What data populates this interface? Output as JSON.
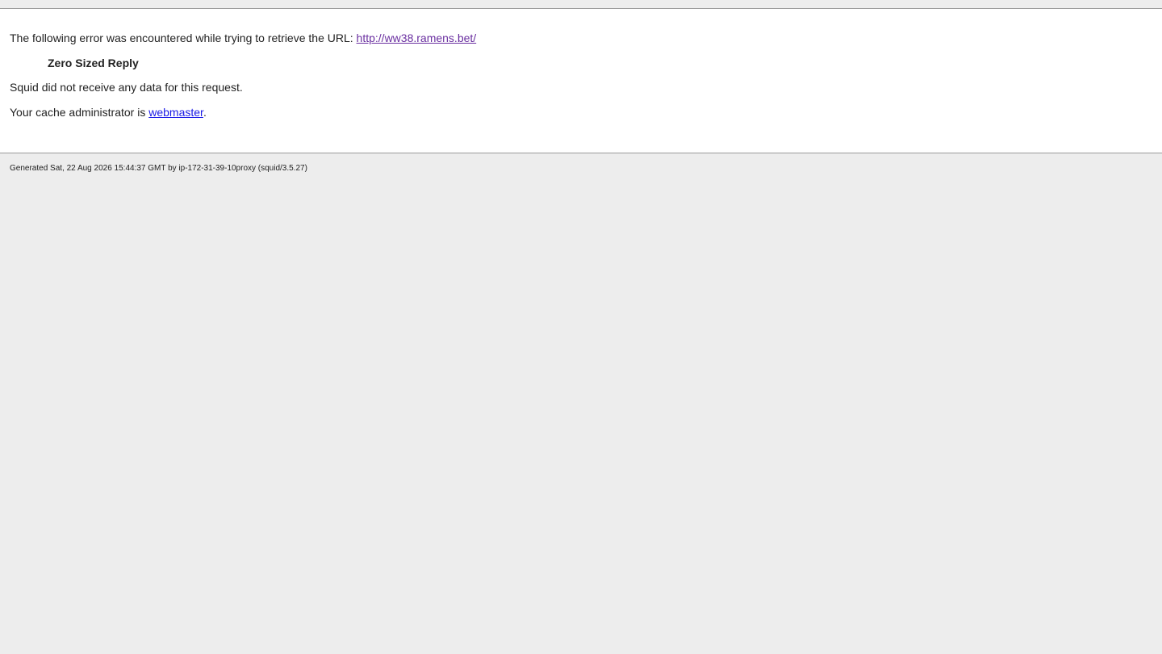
{
  "error": {
    "intro_text": "The following error was encountered while trying to retrieve the URL: ",
    "url": "http://ww38.ramens.bet/",
    "title": "Zero Sized Reply",
    "description": "Squid did not receive any data for this request.",
    "admin_text": "Your cache administrator is ",
    "admin_link": "webmaster",
    "admin_suffix": "."
  },
  "footer": {
    "generated": "Generated Sat, 22 Aug 2026 15:44:37 GMT by ip-172-31-39-10proxy (squid/3.5.27)"
  },
  "colors": {
    "visited_link": "#6a2fa0",
    "link": "#1a1ae6",
    "background": "#ededed",
    "panel": "#ffffff"
  }
}
